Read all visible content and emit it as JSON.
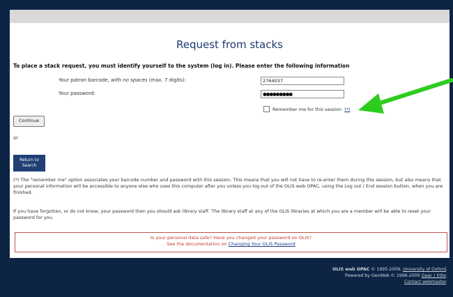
{
  "page": {
    "title": "Request from stacks",
    "intro": "To place a stack request, you must identify yourself to the system (log in). Please enter the following information"
  },
  "form": {
    "barcode_label_prefix": "Your patron barcode, ",
    "barcode_label_italic": "with no spaces",
    "barcode_label_suffix": " (max. 7 digits):",
    "barcode_value": "2764037",
    "password_label": "Your password:",
    "password_value": "●●●●●●●●●",
    "remember_label": "Remember me for this session",
    "remember_link": "(*)",
    "remember_checked": false,
    "continue_label": "Continue",
    "or_text": "or",
    "return_line1": "Return to",
    "return_line2": "Search"
  },
  "notes": {
    "remember_note": "(*) The \"remember me\" option associates your barcode number and password with this session. This means that you will not have to re-enter them during this session, but also means that your personal information will be accessible to anyone else who uses this computer after you unless you log out of the OLIS web OPAC, using the Log out / End session button, when you are finished.",
    "forgot_note": "If you have forgotten, or do not know, your password then you should ask library staff. The library staff at any of the OLIS libraries at which you are a member will be able to reset your password for you."
  },
  "notice": {
    "line1": "Is your personal data safe? Have you changed your password on OLIS?",
    "line2_prefix": "See the documentation on ",
    "line2_link": "Changing Your OLIS Password"
  },
  "footer": {
    "line1_bold": "OLIS web OPAC",
    "line1_text": " © 1995-2009, ",
    "line1_link": "University of Oxford",
    "line1_end": ".",
    "line2_text": "Powered by GeoWeb © 1996-2009 ",
    "line2_link": "Geac / Infor",
    "line2_end": ".",
    "line3_link": "Contact webmaster",
    "line3_end": "."
  },
  "colors": {
    "background": "#0d2444",
    "title": "#1b3a73",
    "arrow": "#2ecc1f",
    "notice_border": "#c0504d"
  }
}
